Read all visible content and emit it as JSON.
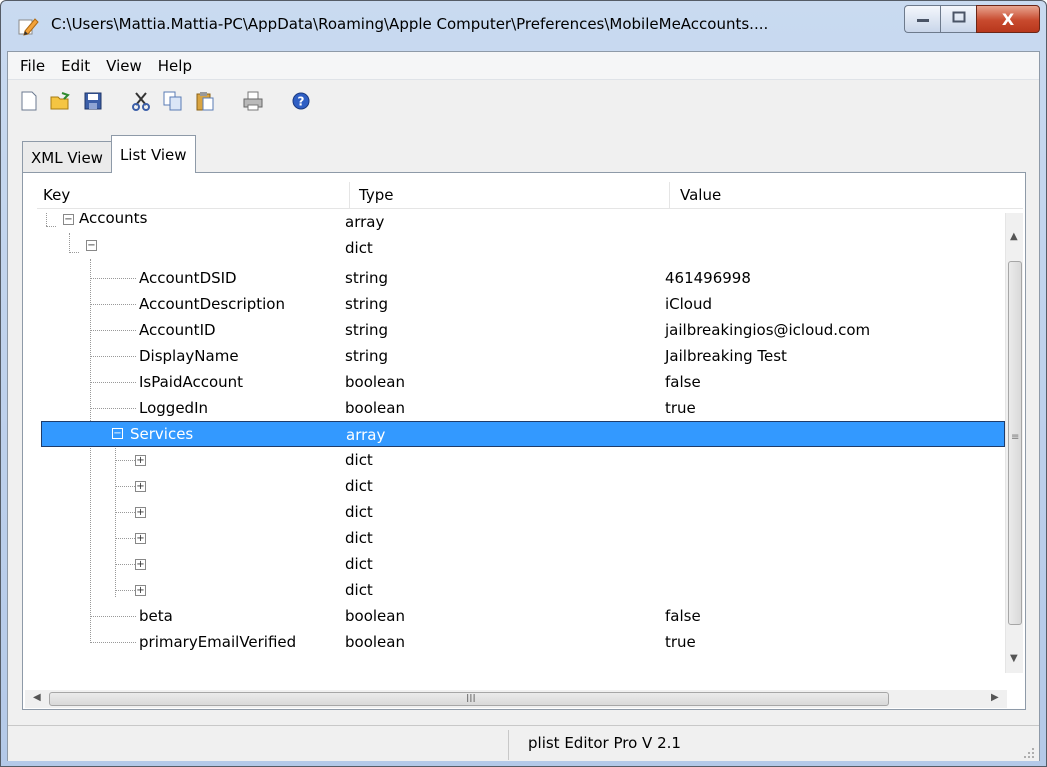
{
  "window": {
    "title": "C:\\Users\\Mattia.Mattia-PC\\AppData\\Roaming\\Apple Computer\\Preferences\\MobileMeAccounts....",
    "min_icon": "minimize-icon",
    "max_icon": "maximize-icon",
    "close_label": "X"
  },
  "menu": [
    "File",
    "Edit",
    "View",
    "Help"
  ],
  "toolbar": {
    "buttons": [
      "new-file-icon",
      "open-folder-icon",
      "save-icon",
      "cut-icon",
      "copy-icon",
      "paste-icon",
      "print-icon",
      "help-icon"
    ]
  },
  "tabs": [
    {
      "label": "XML View",
      "active": false
    },
    {
      "label": "List View",
      "active": true
    }
  ],
  "table": {
    "headers": {
      "key": "Key",
      "type": "Type",
      "value": "Value"
    },
    "rows": [
      {
        "key": "Accounts",
        "type": "array",
        "value": ""
      },
      {
        "key": "",
        "type": "dict",
        "value": ""
      },
      {
        "key": "AccountDSID",
        "type": "string",
        "value": "461496998"
      },
      {
        "key": "AccountDescription",
        "type": "string",
        "value": "iCloud"
      },
      {
        "key": "AccountID",
        "type": "string",
        "value": "jailbreakingios@icloud.com"
      },
      {
        "key": "DisplayName",
        "type": "string",
        "value": "Jailbreaking Test"
      },
      {
        "key": "IsPaidAccount",
        "type": "boolean",
        "value": "false"
      },
      {
        "key": "LoggedIn",
        "type": "boolean",
        "value": "true"
      },
      {
        "key": "Services",
        "type": "array",
        "value": ""
      },
      {
        "key": "",
        "type": "dict",
        "value": ""
      },
      {
        "key": "",
        "type": "dict",
        "value": ""
      },
      {
        "key": "",
        "type": "dict",
        "value": ""
      },
      {
        "key": "",
        "type": "dict",
        "value": ""
      },
      {
        "key": "",
        "type": "dict",
        "value": ""
      },
      {
        "key": "",
        "type": "dict",
        "value": ""
      },
      {
        "key": "beta",
        "type": "boolean",
        "value": "false"
      },
      {
        "key": "primaryEmailVerified",
        "type": "boolean",
        "value": "true"
      }
    ]
  },
  "scrollbar": {
    "grip": "III"
  },
  "status": {
    "text": "plist Editor Pro V 2.1"
  },
  "colors": {
    "selection": "#3399ff",
    "close_button": "#c84a2e"
  }
}
